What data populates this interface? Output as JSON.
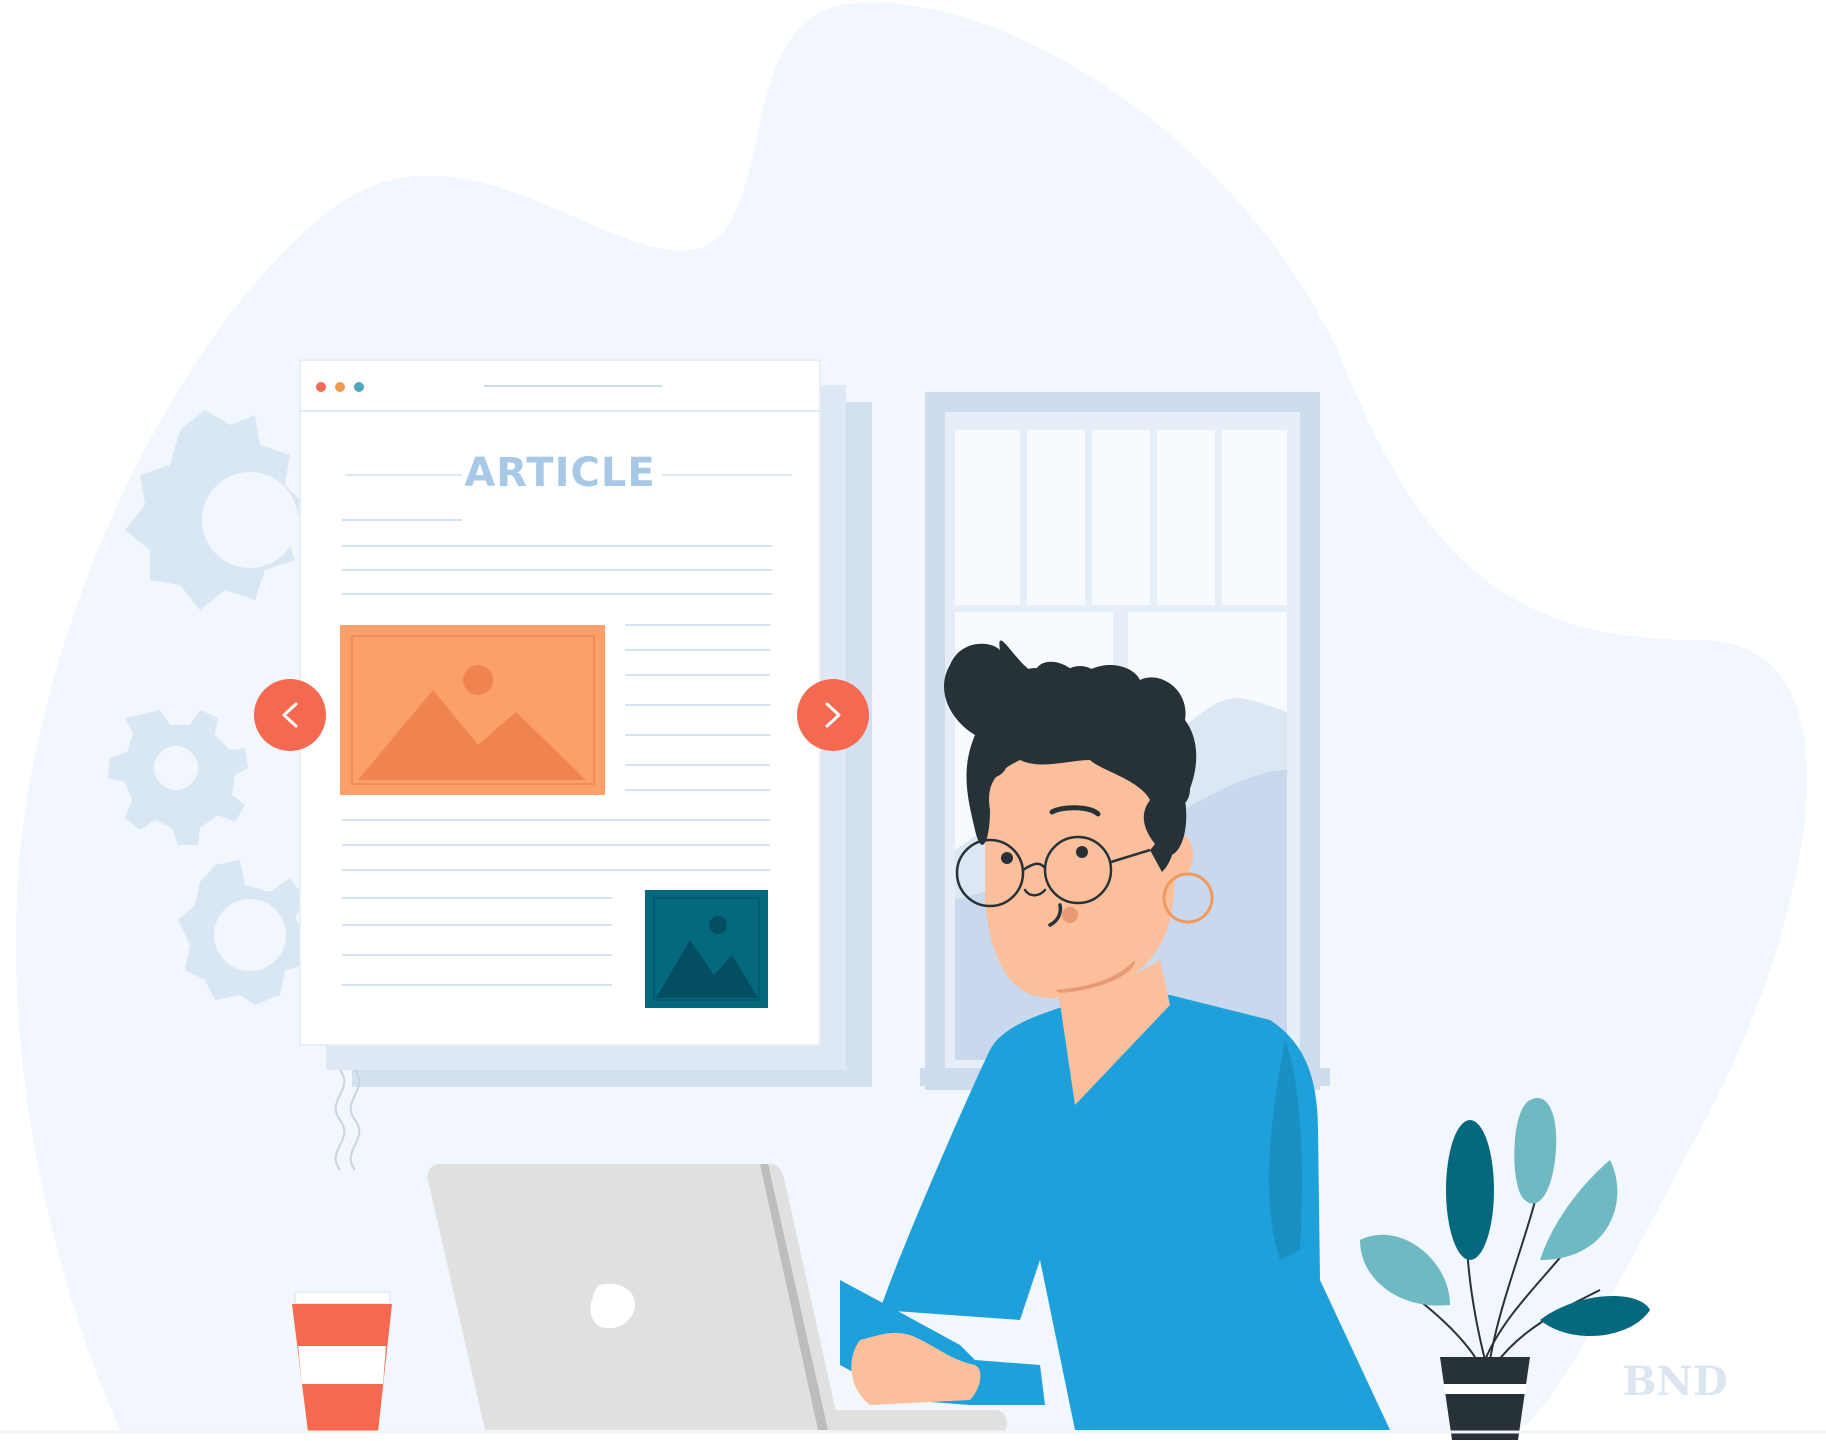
{
  "article": {
    "title": "ARTICLE",
    "window_dots": [
      "#f26a4f",
      "#f29a4f",
      "#4fa8b8"
    ]
  },
  "carousel": {
    "prev_icon": "chevron-left-icon",
    "next_icon": "chevron-right-icon",
    "button_color": "#f4694f"
  },
  "watermark": {
    "text": "BND"
  },
  "colors": {
    "background_blob": "#f2f7fd",
    "gear": "#d9e6f4",
    "sweater": "#1ea1db",
    "skin": "#fbbf9c",
    "hair": "#263238",
    "image_orange": "#fb9f6b",
    "image_teal": "#04687f",
    "laptop": "#e0e0e0",
    "cup_stripe": "#f4694f",
    "plant": "#6fb9c2"
  }
}
